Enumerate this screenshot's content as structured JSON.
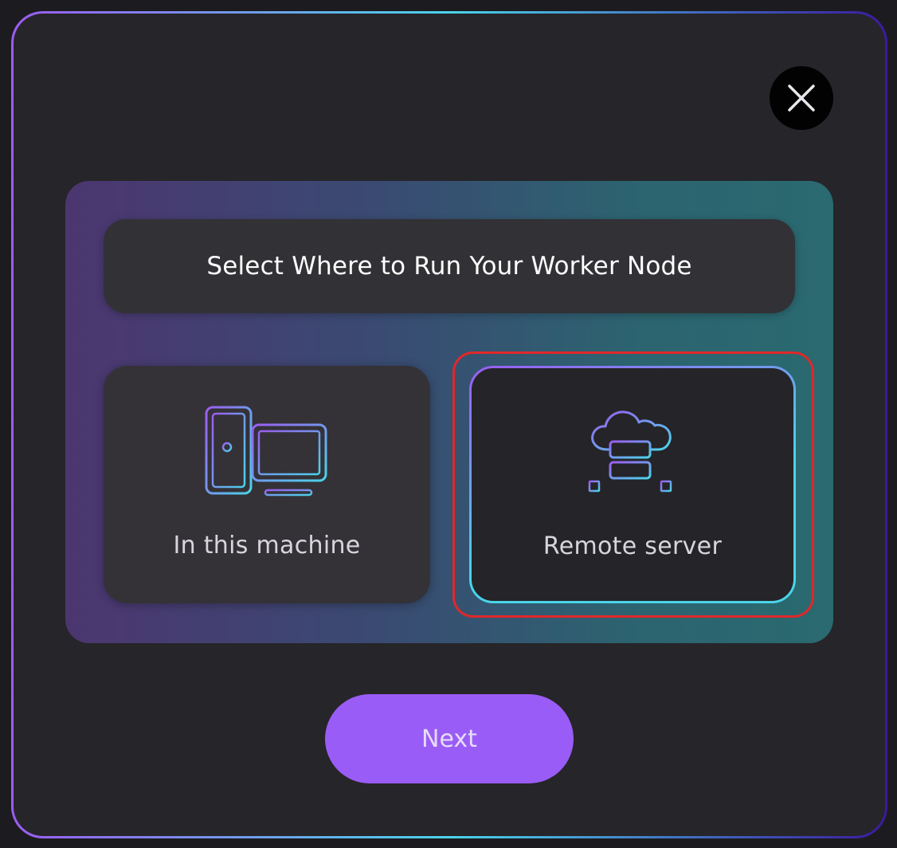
{
  "dialog": {
    "title": "Select Where to Run Your Worker Node",
    "close_icon": "close-icon",
    "options": [
      {
        "label": "In this machine",
        "icon": "desktop-computer-icon",
        "selected": false
      },
      {
        "label": "Remote server",
        "icon": "cloud-server-icon",
        "selected": true
      }
    ],
    "next_label": "Next"
  },
  "colors": {
    "accent": "#9a5cf6",
    "cyan": "#4ad4ea",
    "highlight": "#e0282a",
    "modal_bg": "#262529"
  }
}
